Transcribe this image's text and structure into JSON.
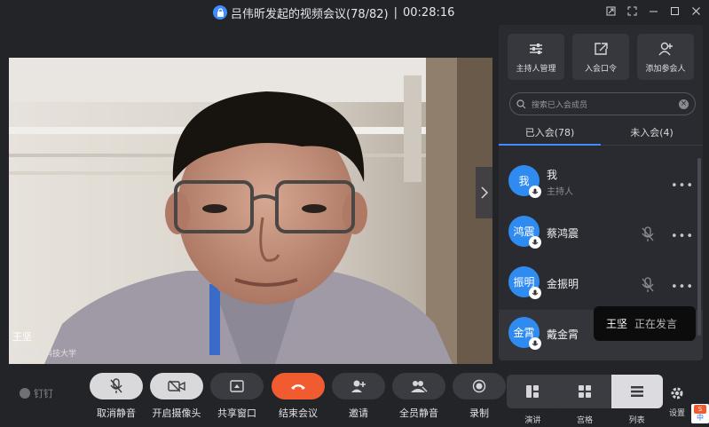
{
  "window": {
    "title": "吕伟昕发起的视频会议(78/82)",
    "separator": "|",
    "timer": "00:28:16",
    "controls": [
      "restore-icon",
      "fullscreen-icon",
      "minimize-icon",
      "maximize-icon",
      "close-icon"
    ]
  },
  "video": {
    "speaker_name": "王坚",
    "speaker_org": "杭州电子科技大学"
  },
  "panel": {
    "buttons": [
      {
        "label": "主持人管理",
        "icon": "sliders-icon"
      },
      {
        "label": "入会口令",
        "icon": "share-out-icon"
      },
      {
        "label": "添加参会人",
        "icon": "add-user-icon"
      }
    ],
    "search_placeholder": "搜索已入会成员",
    "tabs": [
      {
        "label": "已入会(78)",
        "active": true
      },
      {
        "label": "未入会(4)",
        "active": false
      }
    ],
    "members": [
      {
        "avatar": "我",
        "name": "我",
        "role": "主持人",
        "muted": false
      },
      {
        "avatar": "鸿震",
        "name": "蔡鸿震",
        "role": "",
        "muted": true
      },
      {
        "avatar": "振明",
        "name": "金振明",
        "role": "",
        "muted": true
      },
      {
        "avatar": "金霄",
        "name": "戴金霄",
        "role": "",
        "muted": false
      }
    ]
  },
  "toast": {
    "name": "王坚",
    "status": "正在发言"
  },
  "toolbar": {
    "logo": "钉钉",
    "buttons": [
      {
        "label": "取消静音",
        "icon": "mic-off-icon"
      },
      {
        "label": "开启摄像头",
        "icon": "camera-off-icon"
      },
      {
        "label": "共享窗口",
        "icon": "share-screen-icon"
      },
      {
        "label": "结束会议",
        "icon": "hangup-icon"
      },
      {
        "label": "邀请",
        "icon": "invite-icon"
      },
      {
        "label": "全员静音",
        "icon": "mute-all-icon"
      },
      {
        "label": "录制",
        "icon": "record-icon"
      }
    ],
    "layouts": [
      {
        "label": "演讲",
        "selected": false
      },
      {
        "label": "宫格",
        "selected": false
      },
      {
        "label": "列表",
        "selected": true
      }
    ],
    "settings_label": "设置"
  },
  "ime": {
    "logo": "S",
    "mode": "中"
  },
  "colors": {
    "background": "#232428",
    "panel": "#2a2b30",
    "accent_blue": "#3f8cff",
    "avatar_blue": "#2f8bf0",
    "hangup_red": "#f05b30"
  }
}
